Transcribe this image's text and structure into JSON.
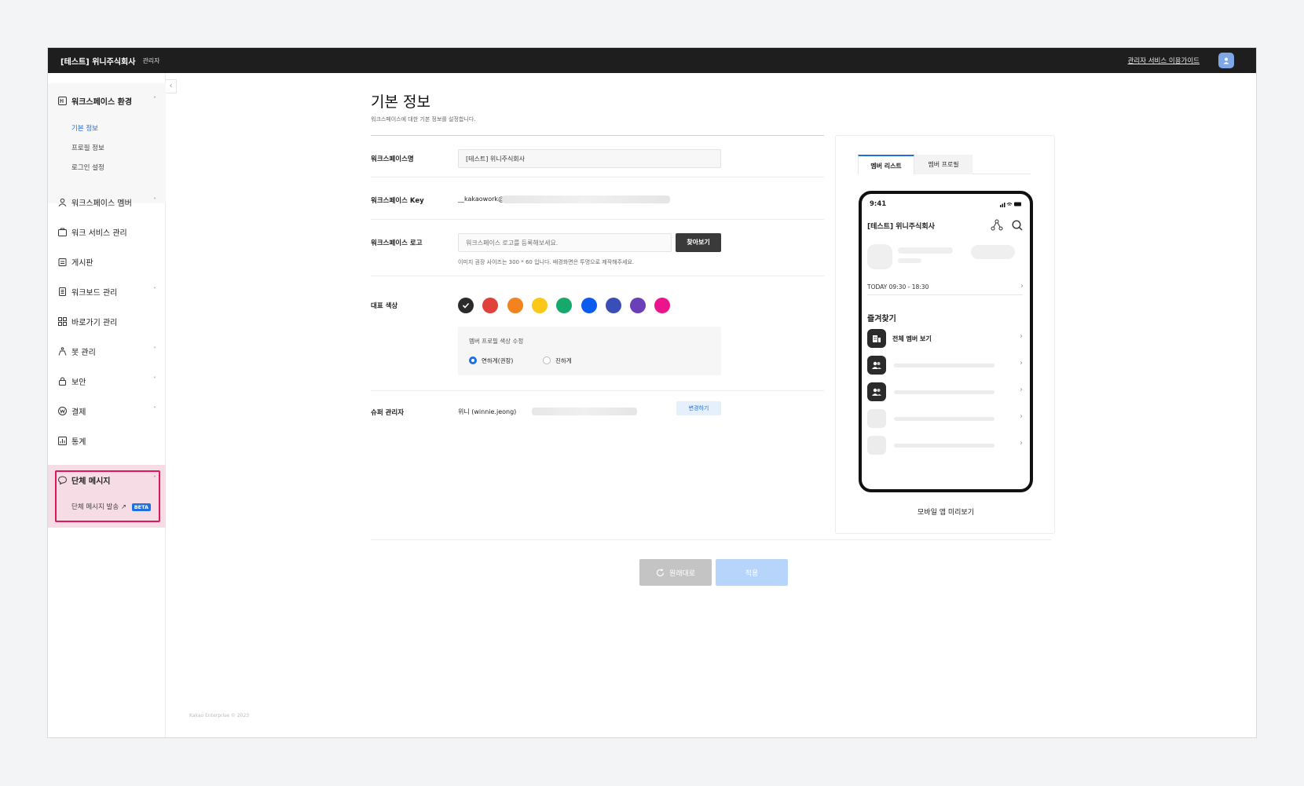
{
  "topbar": {
    "brand": "[테스트] 위니주식회사",
    "role": "관리자",
    "guide_link": "관리자 서비스 이용가이드"
  },
  "sidebar": {
    "workspace_env": "워크스페이스 환경",
    "sub_items": [
      "기본 정보",
      "프로필 정보",
      "로그인 설정"
    ],
    "items": [
      "워크스페이스 멤버",
      "워크 서비스 관리",
      "게시판",
      "워크보드 관리",
      "바로가기 관리",
      "봇 관리",
      "보안",
      "결제",
      "통계"
    ],
    "group_message": "단체 메시지",
    "group_message_send": "단체 메시지 발송",
    "beta": "BETA"
  },
  "main": {
    "title": "기본 정보",
    "description": "워크스페이스에 대한 기본 정보를 설정합니다.",
    "workspace_name_label": "워크스페이스명",
    "workspace_name_value": "[테스트] 위니주식회사",
    "key_label": "워크스페이스 Key",
    "key_value": "__kakaowork@",
    "logo_label": "워크스페이스 로고",
    "logo_placeholder": "워크스페이스 로고를 등록해보세요.",
    "browse_button": "찾아보기",
    "logo_helper": "이미지 권장 사이즈는 300 * 60 입니다. 배경화면은 투명으로 제작해주세요.",
    "color_label": "대표 색상",
    "colors": [
      "#2b2b2b",
      "#e0413b",
      "#f2831f",
      "#fbc818",
      "#17a86b",
      "#0b5bf0",
      "#3a4fb5",
      "#6a3fb8",
      "#ec148c"
    ],
    "profile_color_title": "멤버 프로필 색상 수정",
    "radio_light": "연하게(권장)",
    "radio_dark": "진하게",
    "super_admin_label": "슈퍼 관리자",
    "super_admin_value": "위니 (winnie.jeong)",
    "change_button": "변경하기",
    "reset_button": "원래대로",
    "apply_button": "적용",
    "footer": "Kakao Enterprise © 2023"
  },
  "preview": {
    "tab_member_list": "멤버 리스트",
    "tab_member_profile": "멤버 프로필",
    "time": "9:41",
    "app_title": "[테스트] 위니주식회사",
    "today": "TODAY  09:30 - 18:30",
    "favorites": "즐겨찾기",
    "all_members": "전체 멤버 보기",
    "caption": "모바일 앱 미리보기"
  }
}
